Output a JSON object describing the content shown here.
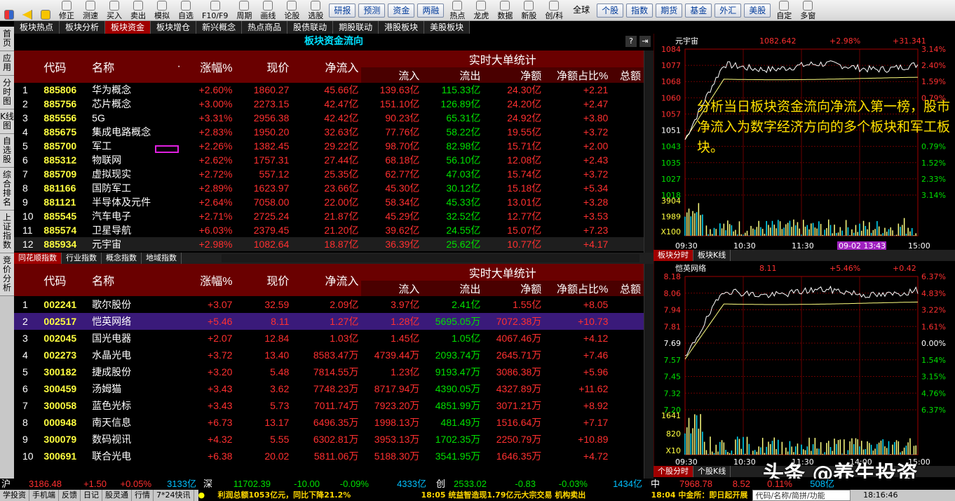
{
  "toolbar": {
    "items": [
      "修正",
      "测速",
      "买入",
      "卖出",
      "模拟",
      "自选",
      "F10/F9",
      "周期",
      "画线",
      "论股",
      "选股"
    ],
    "buttons": [
      "研报",
      "预测",
      "资金",
      "两融"
    ],
    "items2": [
      "热点",
      "龙虎",
      "数据",
      "新股",
      "创/科"
    ],
    "buttons2": [
      "全球",
      "个股",
      "指数",
      "期货",
      "基金",
      "外汇",
      "美股"
    ],
    "items3": [
      "自定",
      "多窗"
    ]
  },
  "tabs": [
    "板块热点",
    "板块分析",
    "板块资金",
    "板块增仓",
    "新兴概念",
    "热点商品",
    "股债联动",
    "期股联动",
    "港股板块",
    "美股板块"
  ],
  "active_tab": "板块资金",
  "sidebar": [
    "首页",
    "应用",
    "分时图",
    "K线图",
    "自选股",
    "综合排名",
    "上证指数",
    "竞价分析"
  ],
  "upper": {
    "title": "板块资金流向",
    "headers": {
      "code": "代码",
      "name": "名称",
      "dot": "·",
      "chg": "涨幅%",
      "price": "现价",
      "net": "净流入",
      "realtime": "实时大单统计",
      "in": "流入",
      "out": "流出",
      "netamt": "净额",
      "ratio": "净额占比%",
      "total": "总额"
    },
    "rows": [
      [
        "1",
        "885806",
        "华为概念",
        "+2.60%",
        "1860.27",
        "45.66亿",
        "139.63亿",
        "115.33亿",
        "24.30亿",
        "+2.21"
      ],
      [
        "2",
        "885756",
        "芯片概念",
        "+3.00%",
        "2273.15",
        "42.47亿",
        "151.10亿",
        "126.89亿",
        "24.20亿",
        "+2.47"
      ],
      [
        "3",
        "885556",
        "5G",
        "+3.31%",
        "2956.38",
        "42.42亿",
        "90.23亿",
        "65.31亿",
        "24.92亿",
        "+3.80"
      ],
      [
        "4",
        "885675",
        "集成电路概念",
        "+2.83%",
        "1950.20",
        "32.63亿",
        "77.76亿",
        "58.22亿",
        "19.55亿",
        "+3.72"
      ],
      [
        "5",
        "885700",
        "军工",
        "+2.26%",
        "1382.45",
        "29.22亿",
        "98.70亿",
        "82.98亿",
        "15.71亿",
        "+2.00"
      ],
      [
        "6",
        "885312",
        "物联网",
        "+2.62%",
        "1757.31",
        "27.44亿",
        "68.18亿",
        "56.10亿",
        "12.08亿",
        "+2.43"
      ],
      [
        "7",
        "885709",
        "虚拟现实",
        "+2.72%",
        "557.12",
        "25.35亿",
        "62.77亿",
        "47.03亿",
        "15.74亿",
        "+3.72"
      ],
      [
        "8",
        "881166",
        "国防军工",
        "+2.89%",
        "1623.97",
        "23.66亿",
        "45.30亿",
        "30.12亿",
        "15.18亿",
        "+5.34"
      ],
      [
        "9",
        "881121",
        "半导体及元件",
        "+2.64%",
        "7058.00",
        "22.00亿",
        "58.34亿",
        "45.33亿",
        "13.01亿",
        "+3.28"
      ],
      [
        "10",
        "885545",
        "汽车电子",
        "+2.71%",
        "2725.24",
        "21.87亿",
        "45.29亿",
        "32.52亿",
        "12.77亿",
        "+3.53"
      ],
      [
        "11",
        "885574",
        "卫星导航",
        "+6.03%",
        "2379.45",
        "21.20亿",
        "39.62亿",
        "24.55亿",
        "15.07亿",
        "+7.23"
      ],
      [
        "12",
        "885934",
        "元宇宙",
        "+2.98%",
        "1082.64",
        "18.87亿",
        "36.39亿",
        "25.62亿",
        "10.77亿",
        "+4.17"
      ]
    ]
  },
  "bottom_tabs": [
    "同花顺指数",
    "行业指数",
    "概念指数",
    "地域指数"
  ],
  "lower": {
    "headers": {
      "code": "代码",
      "name": "名称",
      "chg": "涨幅%",
      "price": "现价",
      "net": "净流入",
      "realtime": "实时大单统计",
      "in": "流入",
      "out": "流出",
      "netamt": "净额",
      "ratio": "净额占比%",
      "total": "总额"
    },
    "rows": [
      [
        "1",
        "002241",
        "歌尔股份",
        "+3.07",
        "32.59",
        "2.09亿",
        "3.97亿",
        "2.41亿",
        "1.55亿",
        "+8.05"
      ],
      [
        "2",
        "002517",
        "恺英网络",
        "+5.46",
        "8.11",
        "1.27亿",
        "1.28亿",
        "5695.05万",
        "7072.38万",
        "+10.73"
      ],
      [
        "3",
        "002045",
        "国光电器",
        "+2.07",
        "12.84",
        "1.03亿",
        "1.45亿",
        "1.05亿",
        "4067.46万",
        "+4.12"
      ],
      [
        "4",
        "002273",
        "水晶光电",
        "+3.72",
        "13.40",
        "8583.47万",
        "4739.44万",
        "2093.74万",
        "2645.71万",
        "+7.46"
      ],
      [
        "5",
        "300182",
        "捷成股份",
        "+3.20",
        "5.48",
        "7814.55万",
        "1.23亿",
        "9193.47万",
        "3086.38万",
        "+5.96"
      ],
      [
        "6",
        "300459",
        "汤姆猫",
        "+3.43",
        "3.62",
        "7748.23万",
        "8717.94万",
        "4390.05万",
        "4327.89万",
        "+11.62"
      ],
      [
        "7",
        "300058",
        "蓝色光标",
        "+3.43",
        "5.73",
        "7011.74万",
        "7923.20万",
        "4851.99万",
        "3071.21万",
        "+8.92"
      ],
      [
        "8",
        "000948",
        "南天信息",
        "+6.73",
        "13.17",
        "6496.35万",
        "1998.13万",
        "481.49万",
        "1516.64万",
        "+7.17"
      ],
      [
        "9",
        "300079",
        "数码视讯",
        "+4.32",
        "5.55",
        "6302.81万",
        "3953.13万",
        "1702.35万",
        "2250.79万",
        "+10.89"
      ],
      [
        "10",
        "300691",
        "联合光电",
        "+6.38",
        "20.02",
        "5811.06万",
        "5188.30万",
        "3541.95万",
        "1646.35万",
        "+4.72"
      ]
    ]
  },
  "chart_top": {
    "name": "元宇宙",
    "price": "1082.642",
    "pct": "+2.98%",
    "chg": "+31.341",
    "left_ticks": [
      "1084",
      "1077",
      "1068",
      "1060",
      "1057",
      "1051",
      "1043",
      "1035",
      "1027",
      "1018"
    ],
    "right_ticks": [
      "3.14%",
      "2.40%",
      "1.59%",
      "0.79%",
      "",
      "",
      "0.79%",
      "1.52%",
      "2.33%",
      "3.14%"
    ],
    "vol_ticks": [
      "3904",
      "1989",
      "X100"
    ],
    "time_ticks": [
      "09:30",
      "10:30",
      "11:30",
      "09-02 13:43",
      "15:00"
    ],
    "tabs": [
      "板块分时",
      "板块K线"
    ]
  },
  "chart_bottom": {
    "name": "恺英网络",
    "price": "8.11",
    "pct": "+5.46%",
    "chg": "+0.42",
    "left_ticks": [
      "8.18",
      "8.06",
      "7.94",
      "7.81",
      "7.69",
      "7.57",
      "7.45",
      "7.32",
      "7.20"
    ],
    "right_ticks": [
      "6.37%",
      "4.83%",
      "3.22%",
      "1.61%",
      "0.00%",
      "1.54%",
      "3.15%",
      "4.76%",
      "6.37%"
    ],
    "vol_ticks": [
      "1641",
      "820",
      "X10"
    ],
    "time_ticks": [
      "09:30",
      "10:30",
      "11:30",
      "14:00",
      "15:00"
    ],
    "tabs": [
      "个股分时",
      "个股K线"
    ]
  },
  "annotation": "分析当日板块资金流向净流入第一榜，股市净流入为数字经济方向的多个板块和军工板块。",
  "watermark": "头条 @养生投资",
  "ticker": {
    "sh_label": "沪",
    "sh": "3186.48",
    "sh_chg": "+1.50",
    "sh_pct": "+0.05%",
    "sh_amt": "3133亿",
    "sz_label": "深",
    "sz": "11702.39",
    "sz_chg": "-10.00",
    "sz_pct": "-0.09%",
    "sz_amt": "4333亿",
    "cy_label": "创",
    "cy": "2533.02",
    "cy_chg": "-0.83",
    "cy_pct": "-0.03%",
    "cy_amt": "1434亿",
    "zz_label": "中",
    "zz": "7968.78",
    "zz_chg": "8.52",
    "zz_pct": "0.11%",
    "zz_amt": "508亿"
  },
  "status": {
    "items": [
      "学投资",
      "手机端",
      "反馈",
      "日记",
      "股灵通",
      "行情",
      "7*24快讯"
    ],
    "news1": "利润总额1053亿元，同比下降21.2%",
    "news2": "18:05 统益智造现1.79亿元大宗交易 机构卖出",
    "news3": "18:04 中金所：即日起开展",
    "search": "代码/名称/简拼/功能",
    "time": "18:16:46"
  }
}
